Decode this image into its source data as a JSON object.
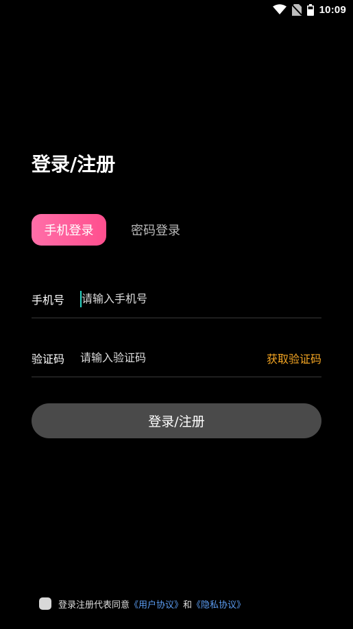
{
  "status_bar": {
    "time": "10:09",
    "icons": [
      "wifi-icon",
      "no-sim-icon",
      "battery-icon"
    ]
  },
  "title": "登录/注册",
  "tabs": [
    {
      "label": "手机登录",
      "active": true
    },
    {
      "label": "密码登录",
      "active": false
    }
  ],
  "form": {
    "phone": {
      "label": "手机号",
      "placeholder": "请输入手机号",
      "value": ""
    },
    "code": {
      "label": "验证码",
      "placeholder": "请输入验证码",
      "value": "",
      "action_label": "获取验证码"
    }
  },
  "submit_label": "登录/注册",
  "agreement": {
    "checked": false,
    "prefix": "登录注册代表同意",
    "user_agreement": "《用户协议》",
    "connector": "和",
    "privacy_agreement": "《隐私协议》"
  },
  "colors": {
    "background": "#000000",
    "tab_active_start": "#ff6ea8",
    "tab_active_end": "#ff4f8e",
    "get_code": "#f5a623",
    "link": "#5b9cf2",
    "button_bg": "#4a4a4a",
    "cursor": "#2fd6c6"
  }
}
